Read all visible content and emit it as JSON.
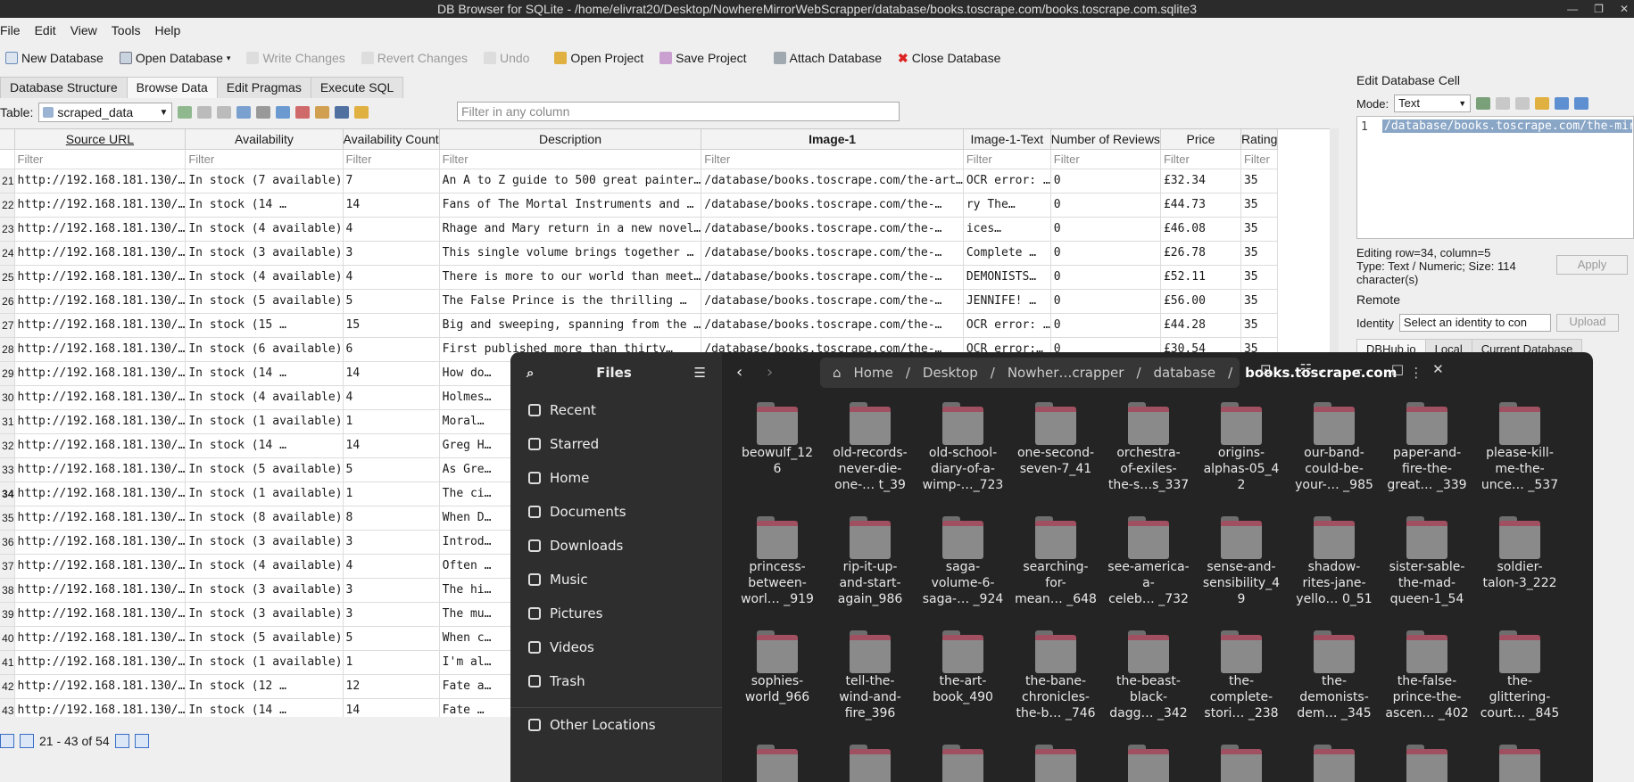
{
  "window": {
    "title": "DB Browser for SQLite - /home/elivrat20/Desktop/NowhereMirrorWebScrapper/database/books.toscrape.com/books.toscrape.com.sqlite3"
  },
  "menu": [
    "File",
    "Edit",
    "View",
    "Tools",
    "Help"
  ],
  "toolbar": {
    "new_db": "New Database",
    "open_db": "Open Database",
    "write": "Write Changes",
    "revert": "Revert Changes",
    "undo": "Undo",
    "open_project": "Open Project",
    "save_project": "Save Project",
    "attach": "Attach Database",
    "close": "Close Database"
  },
  "tabs": [
    "Database Structure",
    "Browse Data",
    "Edit Pragmas",
    "Execute SQL"
  ],
  "browse": {
    "table_label": "Table:",
    "table_value": "scraped_data",
    "filter_placeholder": "Filter in any column",
    "filter_cell": "Filter"
  },
  "columns": [
    "Source URL",
    "Availability",
    "Availability Count",
    "Description",
    "Image-1",
    "Image-1-Text",
    "Number of Reviews",
    "Price",
    "Rating"
  ],
  "rows": [
    [
      "21",
      "http://192.168.181.130/…",
      "In stock (7 available)",
      "7",
      "An A to Z guide to 500 great painter…",
      "/database/books.toscrape.com/the-art…",
      "OCR error: …",
      "0",
      "£32.34",
      "35"
    ],
    [
      "22",
      "http://192.168.181.130/…",
      "In stock (14 …",
      "14",
      "Fans of The Mortal Instruments and …",
      "/database/books.toscrape.com/the-…",
      "ry The…",
      "0",
      "£44.73",
      "35"
    ],
    [
      "23",
      "http://192.168.181.130/…",
      "In stock (4 available)",
      "4",
      "Rhage and Mary return in a new novel…",
      "/database/books.toscrape.com/the-…",
      "ices…",
      "0",
      "£46.08",
      "35"
    ],
    [
      "24",
      "http://192.168.181.130/…",
      "In stock (3 available)",
      "3",
      "This single volume brings together …",
      "/database/books.toscrape.com/the-…",
      "Complete …",
      "0",
      "£26.78",
      "35"
    ],
    [
      "25",
      "http://192.168.181.130/…",
      "In stock (4 available)",
      "4",
      "There is more to our world than meet…",
      "/database/books.toscrape.com/the-…",
      "DEMONISTS…",
      "0",
      "£52.11",
      "35"
    ],
    [
      "26",
      "http://192.168.181.130/…",
      "In stock (5 available)",
      "5",
      "The False Prince is the thrilling …",
      "/database/books.toscrape.com/the-…",
      "JENNIFE! …",
      "0",
      "£56.00",
      "35"
    ],
    [
      "27",
      "http://192.168.181.130/…",
      "In stock (15 …",
      "15",
      "Big and sweeping, spanning from the …",
      "/database/books.toscrape.com/the-…",
      "OCR error: …",
      "0",
      "£44.28",
      "35"
    ],
    [
      "28",
      "http://192.168.181.130/…",
      "In stock (6 available)",
      "6",
      "First published more than thirty…",
      "/database/books.toscrape.com/the-…",
      "OCR error:…",
      "0",
      "£30.54",
      "35"
    ],
    [
      "29",
      "http://192.168.181.130/…",
      "In stock (14 …",
      "14",
      "How do…",
      "",
      "",
      "",
      "",
      ""
    ],
    [
      "30",
      "http://192.168.181.130/…",
      "In stock (4 available)",
      "4",
      "Holmes…",
      "",
      "",
      "",
      "",
      ""
    ],
    [
      "31",
      "http://192.168.181.130/…",
      "In stock (1 available)",
      "1",
      "Moral…",
      "",
      "",
      "",
      "",
      ""
    ],
    [
      "32",
      "http://192.168.181.130/…",
      "In stock (14 …",
      "14",
      "Greg H…",
      "",
      "",
      "",
      "",
      ""
    ],
    [
      "33",
      "http://192.168.181.130/…",
      "In stock (5 available)",
      "5",
      "As Gre…",
      "",
      "",
      "",
      "",
      ""
    ],
    [
      "34",
      "http://192.168.181.130/…",
      "In stock (1 available)",
      "1",
      "The ci…",
      "",
      "",
      "",
      "",
      ""
    ],
    [
      "35",
      "http://192.168.181.130/…",
      "In stock (8 available)",
      "8",
      "When D…",
      "",
      "",
      "",
      "",
      ""
    ],
    [
      "36",
      "http://192.168.181.130/…",
      "In stock (3 available)",
      "3",
      "Introd…",
      "",
      "",
      "",
      "",
      ""
    ],
    [
      "37",
      "http://192.168.181.130/…",
      "In stock (4 available)",
      "4",
      "Often …",
      "",
      "",
      "",
      "",
      ""
    ],
    [
      "38",
      "http://192.168.181.130/…",
      "In stock (3 available)",
      "3",
      "The hi…",
      "",
      "",
      "",
      "",
      ""
    ],
    [
      "39",
      "http://192.168.181.130/…",
      "In stock (3 available)",
      "3",
      "The mu…",
      "",
      "",
      "",
      "",
      ""
    ],
    [
      "40",
      "http://192.168.181.130/…",
      "In stock (5 available)",
      "5",
      "When c…",
      "",
      "",
      "",
      "",
      ""
    ],
    [
      "41",
      "http://192.168.181.130/…",
      "In stock (1 available)",
      "1",
      "I'm al…",
      "",
      "",
      "",
      "",
      ""
    ],
    [
      "42",
      "http://192.168.181.130/…",
      "In stock (12 …",
      "12",
      "Fate a…",
      "",
      "",
      "",
      "",
      ""
    ],
    [
      "43",
      "http://192.168.181.130/…",
      "In stock (14 …",
      "14",
      "Fate …",
      "",
      "",
      "",
      "",
      ""
    ]
  ],
  "pager": {
    "text": "21 - 43 of 54"
  },
  "edit_cell": {
    "title": "Edit Database Cell",
    "mode_label": "Mode:",
    "mode_value": "Text",
    "line_no": "1",
    "content": "/database/books.toscrape.com/the-mir",
    "info1": "Editing row=34, column=5",
    "info2": "Type: Text / Numeric; Size: 114 character(s)",
    "apply": "Apply",
    "remote": "Remote",
    "identity_label": "Identity",
    "identity_value": "Select an identity to con",
    "upload": "Upload",
    "tabs": [
      "DBHub.io",
      "Local",
      "Current Database"
    ]
  },
  "files": {
    "title": "Files",
    "path": [
      "Home",
      "Desktop",
      "Nowher…crapper",
      "database",
      "books.toscrape.com"
    ],
    "sidebar": [
      "Recent",
      "Starred",
      "Home",
      "Documents",
      "Downloads",
      "Music",
      "Pictures",
      "Videos",
      "Trash",
      "Other Locations"
    ],
    "folders": [
      [
        "beowulf_12",
        "6",
        ""
      ],
      [
        "old-records-",
        "never-die-",
        "one-…  t_39"
      ],
      [
        "old-school-",
        "diary-of-a-",
        "wimp-…_723"
      ],
      [
        "one-second-",
        "seven-7_41",
        ""
      ],
      [
        "orchestra-",
        "of-exiles-",
        "the-s…s_337"
      ],
      [
        "origins-",
        "alphas-05_4",
        "2"
      ],
      [
        "our-band-",
        "could-be-",
        "your-… _985"
      ],
      [
        "paper-and-",
        "fire-the-",
        "great… _339"
      ],
      [
        "please-kill-",
        "me-the-",
        "unce… _537"
      ],
      [
        "princess-",
        "between-",
        "worl… _919"
      ],
      [
        "rip-it-up-",
        "and-start-",
        "again_986"
      ],
      [
        "saga-",
        "volume-6-",
        "saga-… _924"
      ],
      [
        "searching-",
        "for-",
        "mean… _648"
      ],
      [
        "see-america-",
        "a-",
        "celeb… _732"
      ],
      [
        "sense-and-",
        "sensibility_4",
        "9"
      ],
      [
        "shadow-",
        "rites-jane-",
        "yello… 0_51"
      ],
      [
        "sister-sable-",
        "the-mad-",
        "queen-1_54"
      ],
      [
        "soldier-",
        "talon-3_222",
        ""
      ],
      [
        "sophies-",
        "world_966",
        ""
      ],
      [
        "tell-the-",
        "wind-and-",
        "fire_396"
      ],
      [
        "the-art-",
        "book_490",
        ""
      ],
      [
        "the-bane-",
        "chronicles-",
        "the-b… _746"
      ],
      [
        "the-beast-",
        "black-",
        "dagg… _342"
      ],
      [
        "the-",
        "complete-",
        "stori… _238"
      ],
      [
        "the-",
        "demonists-",
        "dem… _345"
      ],
      [
        "the-false-",
        "prince-the-",
        "ascen… _402"
      ],
      [
        "the-",
        "glittering-",
        "court… _845"
      ]
    ]
  }
}
